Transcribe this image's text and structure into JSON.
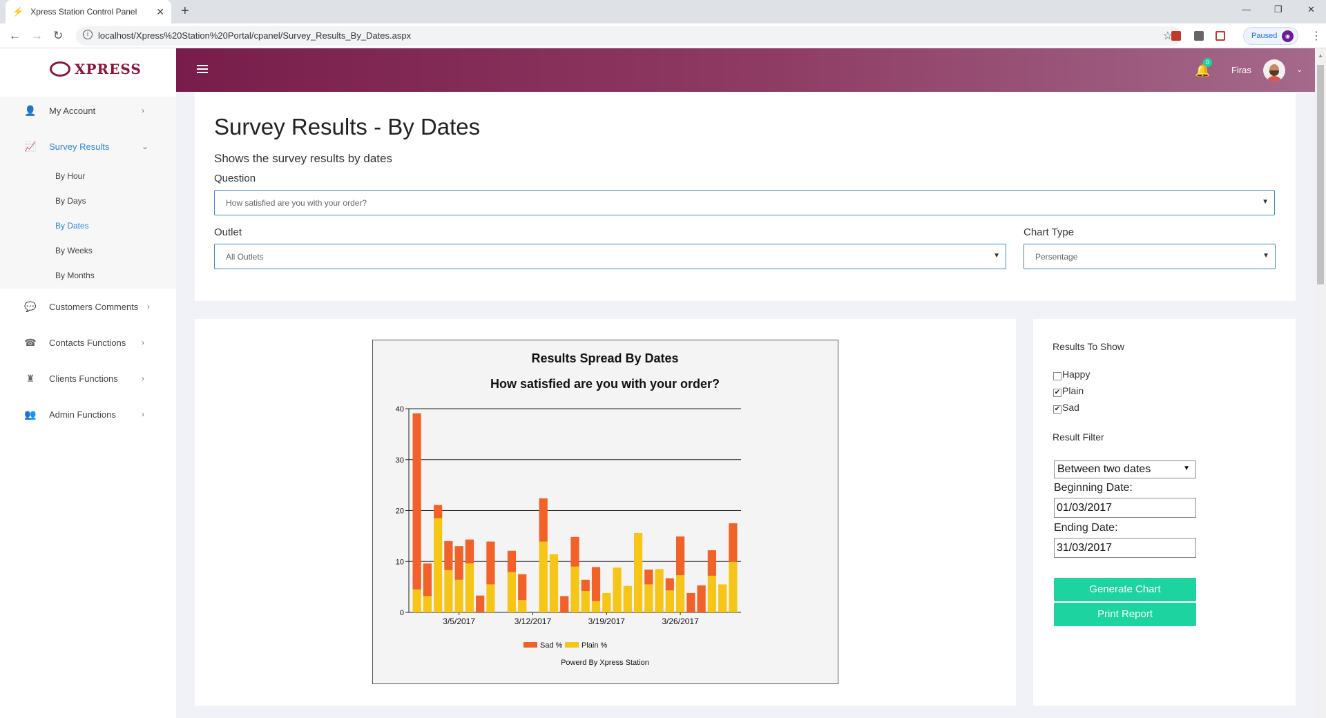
{
  "browser": {
    "tab_title": "Xpress Station Control Panel",
    "url": "localhost/Xpress%20Station%20Portal/cpanel/Survey_Results_By_Dates.aspx",
    "paused_label": "Paused"
  },
  "logo": {
    "text": "XPRESS"
  },
  "sidebar": {
    "items": [
      {
        "label": "My Account",
        "icon": "user-icon"
      },
      {
        "label": "Survey Results",
        "icon": "chart-icon"
      },
      {
        "label": "Customers Comments",
        "icon": "comment-icon"
      },
      {
        "label": "Contacts Functions",
        "icon": "phone-icon"
      },
      {
        "label": "Clients Functions",
        "icon": "chess-icon"
      },
      {
        "label": "Admin Functions",
        "icon": "users-icon"
      }
    ],
    "submenu": [
      "By Hour",
      "By Days",
      "By Dates",
      "By Weeks",
      "By Months"
    ]
  },
  "header": {
    "notification_count": "0",
    "username": "Firas"
  },
  "page": {
    "title": "Survey Results - By Dates",
    "subtitle": "Shows the survey results by dates",
    "question_label": "Question",
    "question_value": "How satisfied are you with your order?",
    "outlet_label": "Outlet",
    "outlet_value": "All Outlets",
    "chart_type_label": "Chart Type",
    "chart_type_value": "Persentage"
  },
  "options": {
    "results_to_show_label": "Results To Show",
    "checkboxes": [
      {
        "label": "Happy",
        "checked": false
      },
      {
        "label": "Plain",
        "checked": true
      },
      {
        "label": "Sad",
        "checked": true
      }
    ],
    "result_filter_label": "Result Filter",
    "filter_value": "Between two dates",
    "beginning_label": "Beginning Date:",
    "beginning_value": "01/03/2017",
    "ending_label": "Ending Date:",
    "ending_value": "31/03/2017",
    "generate_label": "Generate Chart",
    "print_label": "Print Report"
  },
  "chart_data": {
    "type": "bar",
    "stacked": true,
    "title": "Results Spread By Dates",
    "subtitle": "How satisfied are you with your order?",
    "footer": "Powerd By Xpress Station",
    "ylim": [
      0,
      40
    ],
    "yticks": [
      0,
      10,
      20,
      30,
      40
    ],
    "xtick_labels": [
      {
        "label": "3/5/2017",
        "index": 4
      },
      {
        "label": "3/12/2017",
        "index": 11
      },
      {
        "label": "3/19/2017",
        "index": 18
      },
      {
        "label": "3/26/2017",
        "index": 25
      }
    ],
    "categories": [
      "3/1/2017",
      "3/2/2017",
      "3/3/2017",
      "3/4/2017",
      "3/5/2017",
      "3/6/2017",
      "3/7/2017",
      "3/8/2017",
      "3/9/2017",
      "3/10/2017",
      "3/11/2017",
      "3/12/2017",
      "3/13/2017",
      "3/14/2017",
      "3/15/2017",
      "3/16/2017",
      "3/17/2017",
      "3/18/2017",
      "3/19/2017",
      "3/20/2017",
      "3/21/2017",
      "3/22/2017",
      "3/23/2017",
      "3/24/2017",
      "3/25/2017",
      "3/26/2017",
      "3/27/2017",
      "3/28/2017",
      "3/29/2017",
      "3/30/2017",
      "3/31/2017"
    ],
    "series": [
      {
        "name": "Plain %",
        "color": "#f5c518",
        "values": [
          4.5,
          3.2,
          18.5,
          8.3,
          6.4,
          9.6,
          0,
          5.5,
          0,
          7.9,
          2.4,
          0,
          13.9,
          11.4,
          0,
          9.0,
          4.2,
          2.2,
          3.8,
          8.8,
          5.2,
          15.6,
          5.5,
          8.5,
          4.3,
          7.3,
          0,
          0,
          7.2,
          5.5,
          9.9
        ]
      },
      {
        "name": "Sad %",
        "color": "#f16128",
        "values": [
          34.6,
          6.4,
          2.6,
          5.7,
          6.6,
          4.7,
          3.3,
          8.4,
          0,
          4.2,
          5.1,
          0,
          8.5,
          0,
          3.2,
          5.8,
          2.2,
          6.7,
          0,
          0,
          0,
          0,
          2.9,
          0,
          2.4,
          7.6,
          3.8,
          5.3,
          5.0,
          0,
          7.6
        ]
      }
    ]
  }
}
